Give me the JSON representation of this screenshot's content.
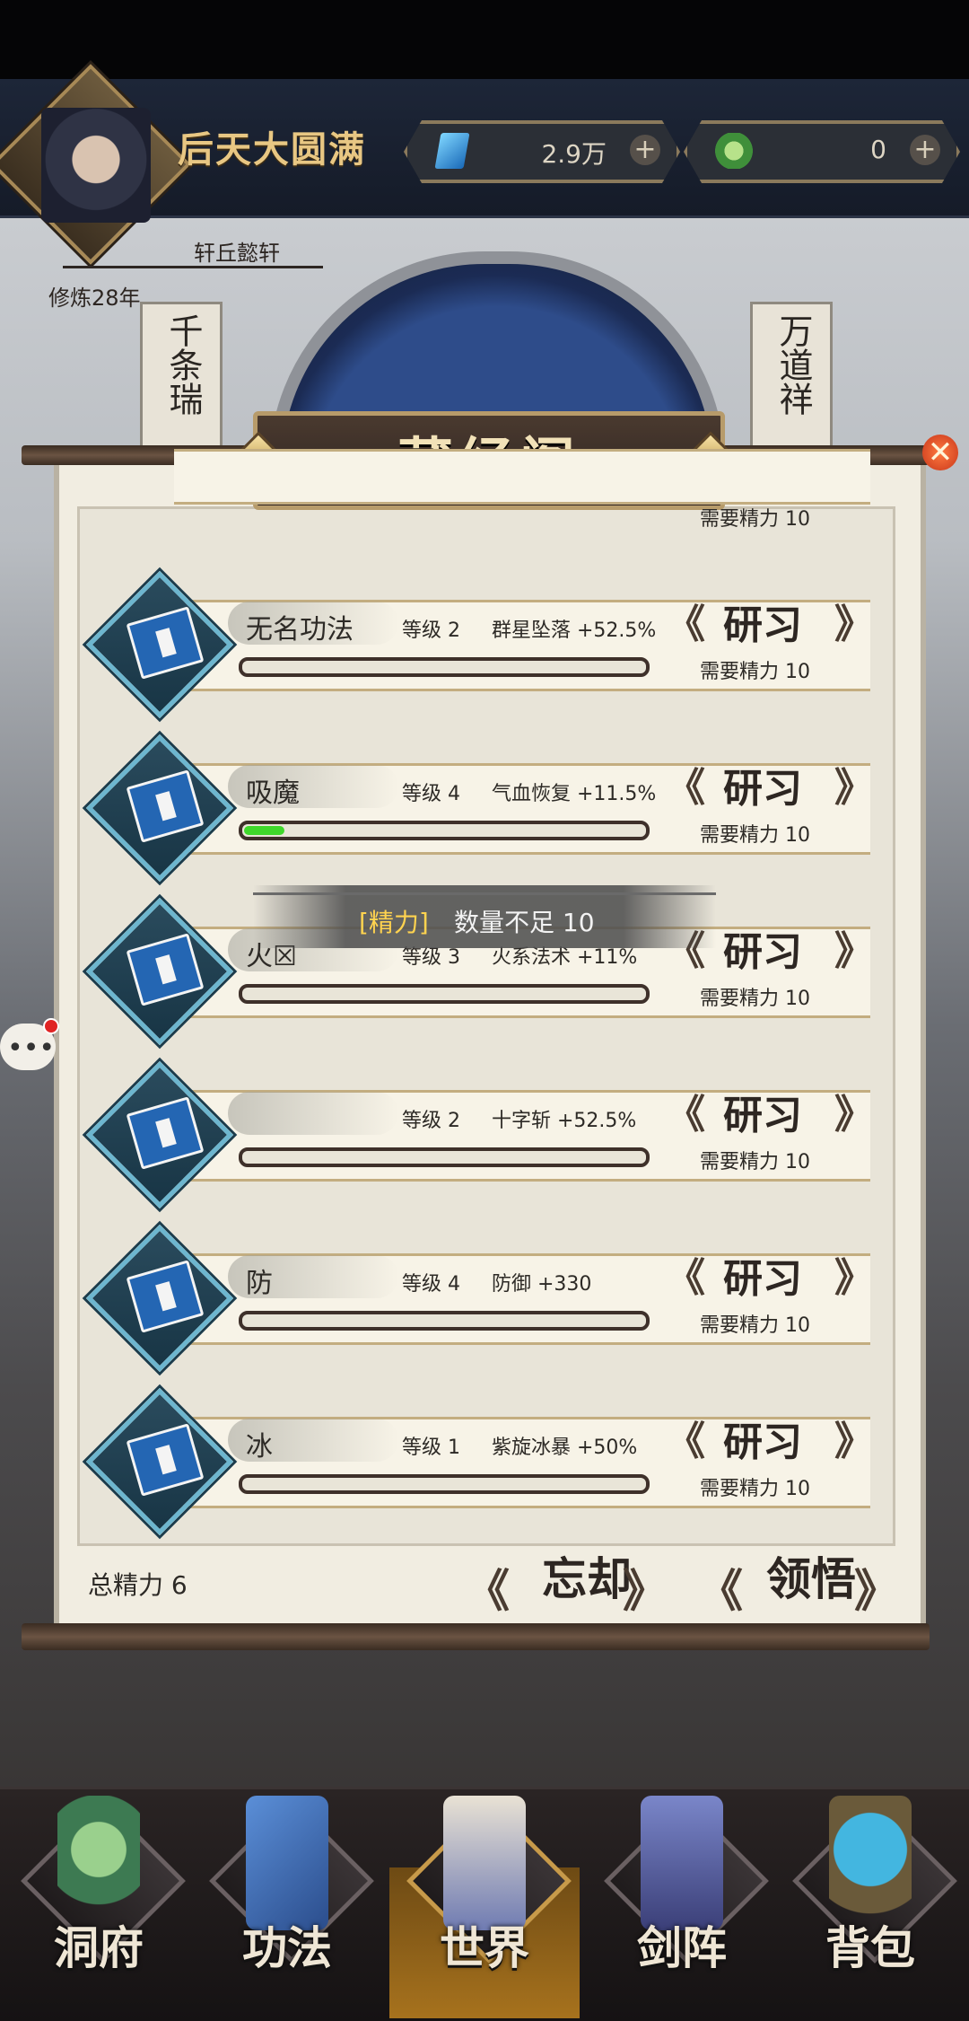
{
  "header": {
    "realm": "后天大圆满",
    "player_name": "轩丘懿轩",
    "cultivation_years": "修炼28年",
    "currency_gems": "2.9万",
    "currency_jade": "0"
  },
  "background": {
    "scroll_left": "千条瑞",
    "scroll_right": "万道祥"
  },
  "panel": {
    "title": "藏经阁",
    "close_symbol": "✕"
  },
  "toast": {
    "key": "[精力]",
    "message": "数量不足 10"
  },
  "skills": [
    {
      "name": "无名功法",
      "level": "等级 2",
      "effect": "群星坠落 +52.5%",
      "progress": 0,
      "button": "研习",
      "cost": "需要精力 10"
    },
    {
      "name": "吸魔",
      "level": "等级 4",
      "effect": "气血恢复 +11.5%",
      "progress": 0.1,
      "button": "研习",
      "cost": "需要精力 10"
    },
    {
      "name": "火☒",
      "level": "等级 3",
      "effect": "火系法术 +11%",
      "progress": 0,
      "button": "研习",
      "cost": "需要精力 10"
    },
    {
      "name": "",
      "level": "等级 2",
      "effect": "十字斩 +52.5%",
      "progress": 0,
      "button": "研习",
      "cost": "需要精力 10"
    },
    {
      "name": "防",
      "level": "等级 4",
      "effect": "防御 +330",
      "progress": 0,
      "button": "研习",
      "cost": "需要精力 10"
    },
    {
      "name": "冰",
      "level": "等级 1",
      "effect": "紫旋冰暴 +50%",
      "progress": 0,
      "button": "研习",
      "cost": "需要精力 10"
    }
  ],
  "partial_top_row": {
    "cost": "需要精力 10"
  },
  "footer": {
    "total_energy": "总精力 6",
    "forget_button": "忘却",
    "comprehend_button": "领悟"
  },
  "nav": [
    {
      "label": "洞府",
      "icon": "immortal-figure-icon"
    },
    {
      "label": "功法",
      "icon": "scroll-book-icon"
    },
    {
      "label": "世界",
      "icon": "world-banner-icon"
    },
    {
      "label": "剑阵",
      "icon": "sword-formation-icon"
    },
    {
      "label": "背包",
      "icon": "bag-icon"
    }
  ],
  "chat": {
    "symbol": "•••"
  }
}
